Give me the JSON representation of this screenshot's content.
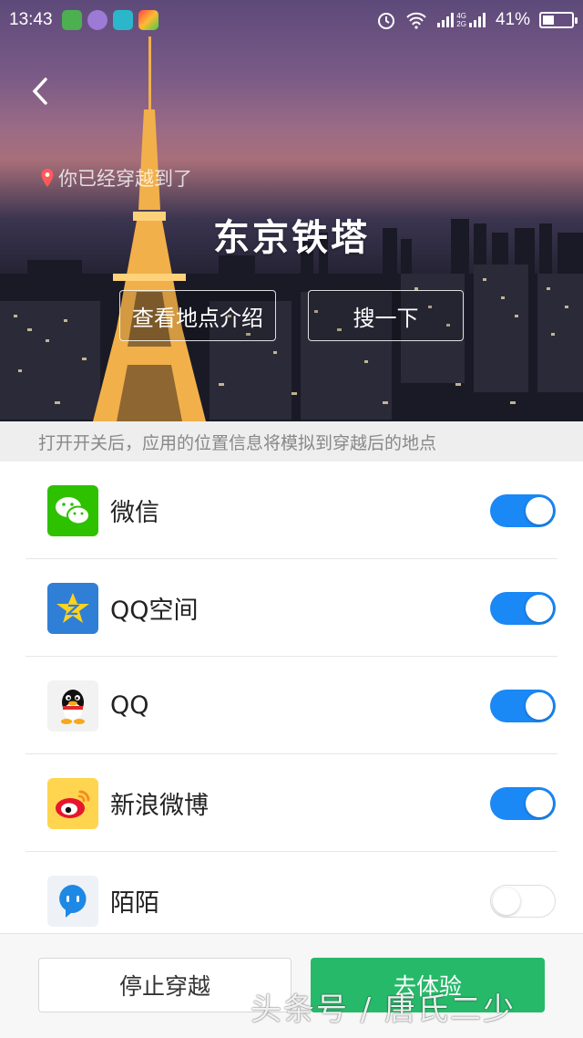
{
  "status_bar": {
    "time": "13:43",
    "battery": "41%",
    "battery_level": 0.41,
    "network_label_top": "4G",
    "network_label_bottom": "2G"
  },
  "hero": {
    "location_prefix": "你已经穿越到了",
    "place_name": "东京铁塔",
    "intro_button": "查看地点介绍",
    "search_button": "搜一下"
  },
  "hint": "打开开关后，应用的位置信息将模拟到穿越后的地点",
  "apps": [
    {
      "label": "微信",
      "enabled": true,
      "icon": "wechat-icon"
    },
    {
      "label": "QQ空间",
      "enabled": true,
      "icon": "qzone-icon"
    },
    {
      "label": "QQ",
      "enabled": true,
      "icon": "qq-icon"
    },
    {
      "label": "新浪微博",
      "enabled": true,
      "icon": "weibo-icon"
    },
    {
      "label": "陌陌",
      "enabled": false,
      "icon": "momo-icon"
    }
  ],
  "bottom": {
    "stop_button": "停止穿越",
    "go_button": "去体验"
  },
  "watermark": "头条号 / 唐氏二少",
  "colors": {
    "toggle_on": "#1a88f5",
    "go_button": "#27b96a"
  }
}
